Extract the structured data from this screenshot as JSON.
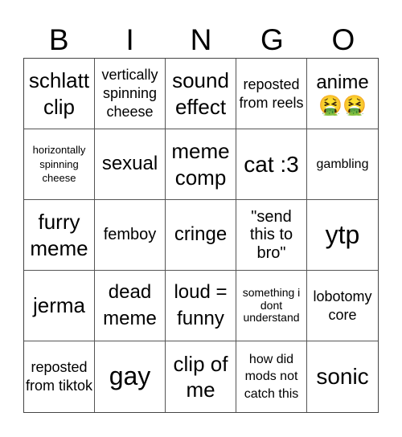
{
  "header": {
    "letters": [
      "B",
      "I",
      "N",
      "G",
      "O"
    ]
  },
  "card": {
    "cells": [
      [
        "schlatt clip",
        "vertically spinning cheese",
        "sound effect",
        "reposted from reels",
        "anime"
      ],
      [
        "horizontally spinning cheese",
        "sexual",
        "meme comp",
        "cat :3",
        "gambling"
      ],
      [
        "furry meme",
        "femboy",
        "cringe",
        "\"send this to bro\"",
        "ytp"
      ],
      [
        "jerma",
        "dead meme",
        "loud = funny",
        "something i dont understand",
        "lobotomy core"
      ],
      [
        "reposted from tiktok",
        "gay",
        "clip of me",
        "how did mods not catch this",
        "sonic"
      ]
    ],
    "anime_emoji": "🤮🤮"
  }
}
